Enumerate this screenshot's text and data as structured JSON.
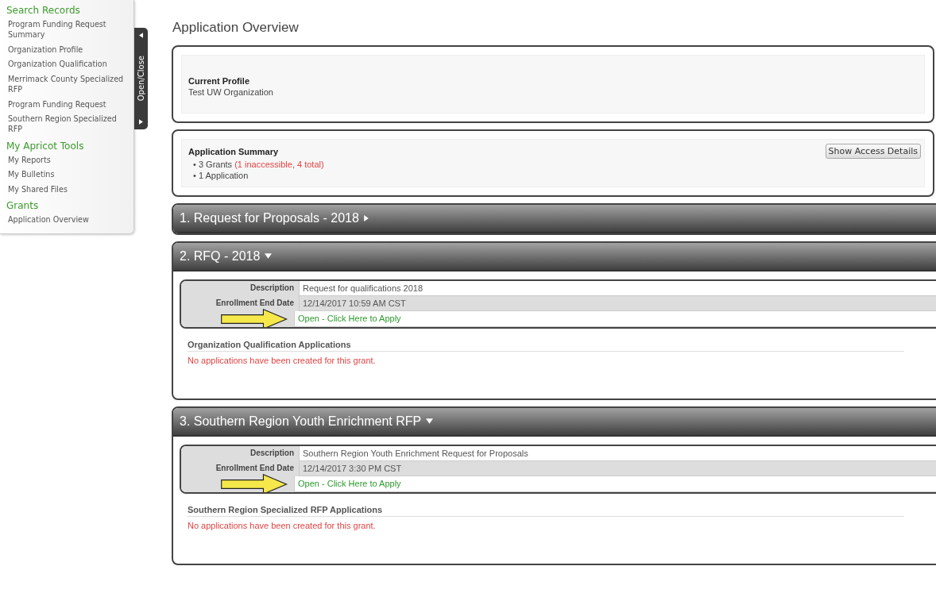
{
  "sidebar": {
    "toggle_label": "Open/Close",
    "sections": [
      {
        "heading": "Search Records",
        "items": [
          {
            "label": "Program Funding Request Summary"
          },
          {
            "label": "Organization Profile"
          },
          {
            "label": "Organization Qualification"
          },
          {
            "label": "Merrimack County Specialized RFP"
          },
          {
            "label": "Program Funding Request"
          },
          {
            "label": "Southern Region Specialized RFP"
          }
        ]
      },
      {
        "heading": "My Apricot Tools",
        "items": [
          {
            "label": "My Reports"
          },
          {
            "label": "My Bulletins"
          },
          {
            "label": "My Shared Files"
          }
        ]
      },
      {
        "heading": "Grants",
        "items": [
          {
            "label": "Application Overview"
          }
        ]
      }
    ]
  },
  "page_title": "Application Overview",
  "current_profile": {
    "heading": "Current Profile",
    "value": "Test UW Organization"
  },
  "application_summary": {
    "heading": "Application Summary",
    "button": "Show Access Details",
    "lines": [
      "• 3 Grants **(1 inaccessible, 4 total)**",
      "• 1 Application"
    ]
  },
  "grants": [
    {
      "title": "1. Request for Proposals - 2018",
      "expanded": false
    },
    {
      "title": "2. RFQ - 2018",
      "expanded": true,
      "details": [
        {
          "label": "Description",
          "value": "Request for qualifications 2018"
        },
        {
          "label": "Enrollment End Date",
          "value": "12/14/2017 10:59 AM CST"
        }
      ],
      "apply_link": "Open - Click Here to Apply",
      "applications_heading": "Organization Qualification Applications",
      "empty_message": "No applications have been created for this grant."
    },
    {
      "title": "3. Southern Region Youth Enrichment RFP",
      "expanded": true,
      "details": [
        {
          "label": "Description",
          "value": "Southern Region Youth Enrichment Request for Proposals"
        },
        {
          "label": "Enrollment End Date",
          "value": "12/14/2017 3:30 PM CST"
        }
      ],
      "apply_link": "Open - Click Here to Apply",
      "applications_heading": "Southern Region Specialized RFP Applications",
      "empty_message": "No applications have been created for this grant."
    }
  ]
}
